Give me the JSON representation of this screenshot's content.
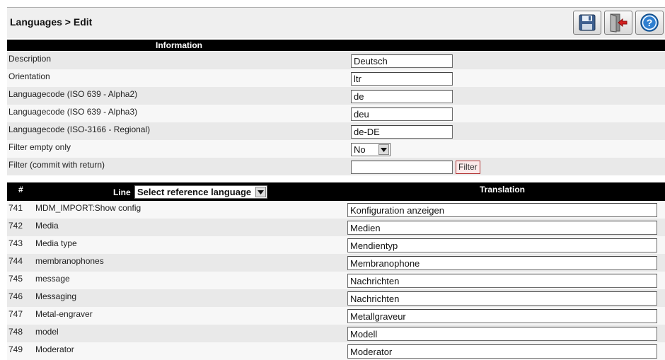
{
  "header": {
    "title": "Languages > Edit",
    "buttons": [
      {
        "name": "save-button",
        "icon": "floppy-disk-icon"
      },
      {
        "name": "exit-button",
        "icon": "door-exit-icon"
      },
      {
        "name": "help-button",
        "icon": "question-mark-icon"
      }
    ]
  },
  "info": {
    "section_title": "Information",
    "description_label": "Description",
    "description_value": "Deutsch",
    "orientation_label": "Orientation",
    "orientation_value": "ltr",
    "alpha2_label": "Languagecode (ISO 639 - Alpha2)",
    "alpha2_value": "de",
    "alpha3_label": "Languagecode (ISO 639 - Alpha3)",
    "alpha3_value": "deu",
    "regional_label": "Languagecode (ISO-3166 - Regional)",
    "regional_value": "de-DE",
    "filter_empty_label": "Filter empty only",
    "filter_empty_value": "No",
    "filter_label": "Filter (commit with return)",
    "filter_value": "",
    "filter_button": "Filter"
  },
  "table": {
    "col_num": "#",
    "col_line": "Line",
    "reference_select": "Select reference language",
    "col_translation": "Translation",
    "rows": [
      {
        "num": "741",
        "key": "MDM_IMPORT:Show config",
        "translation": "Konfiguration anzeigen"
      },
      {
        "num": "742",
        "key": "Media",
        "translation": "Medien"
      },
      {
        "num": "743",
        "key": "Media type",
        "translation": "Mendientyp"
      },
      {
        "num": "744",
        "key": "membranophones",
        "translation": "Membranophone"
      },
      {
        "num": "745",
        "key": "message",
        "translation": "Nachrichten"
      },
      {
        "num": "746",
        "key": "Messaging",
        "translation": "Nachrichten"
      },
      {
        "num": "747",
        "key": "Metal-engraver",
        "translation": "Metallgraveur"
      },
      {
        "num": "748",
        "key": "model",
        "translation": "Modell"
      },
      {
        "num": "749",
        "key": "Moderator",
        "translation": "Moderator"
      }
    ]
  },
  "colors": {
    "header_bar": "#000000",
    "row_alt": "#e9e9e9",
    "row_plain": "#f7f7f7",
    "filter_border": "#b03030"
  }
}
